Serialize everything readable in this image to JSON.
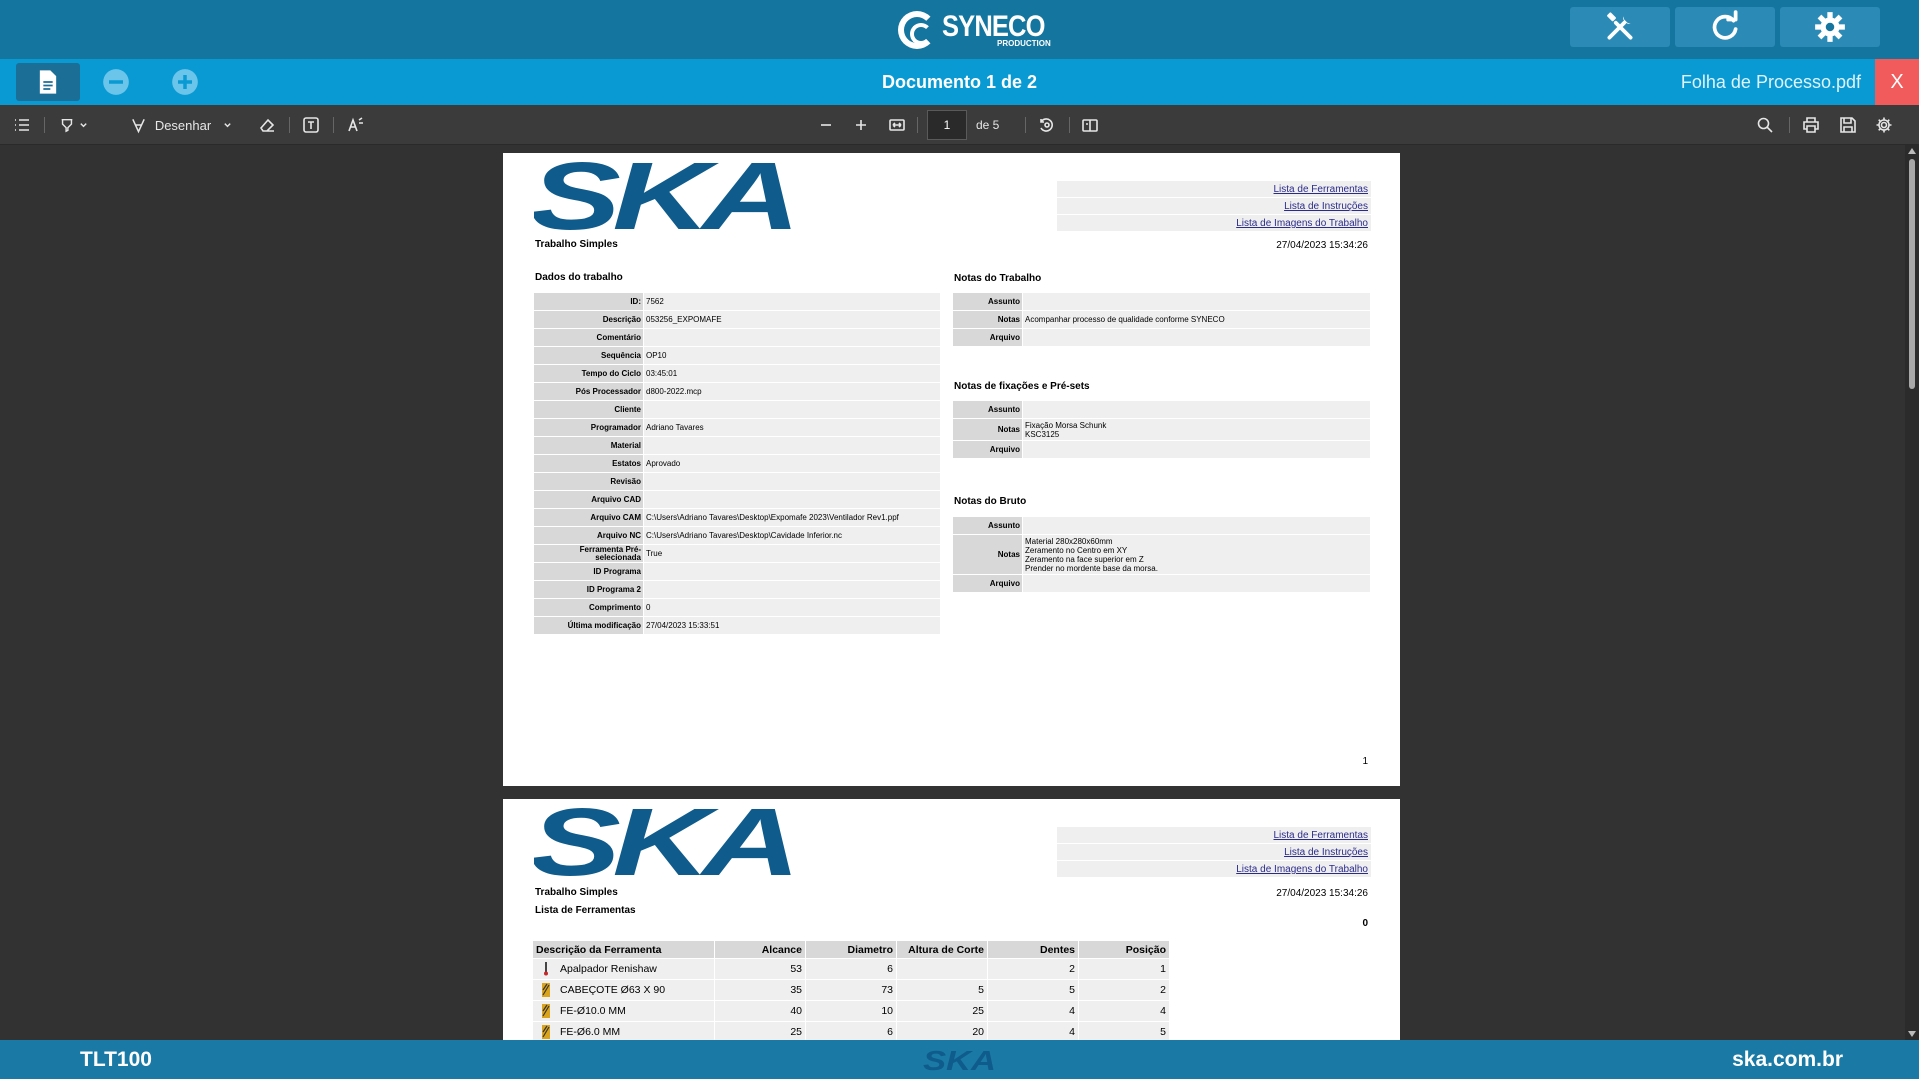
{
  "header": {
    "brand_name": "SYNECO",
    "brand_sub": "PRODUCTION",
    "buttons": [
      "tools-icon",
      "refresh-icon",
      "gear-icon"
    ]
  },
  "docbar": {
    "title": "Documento 1 de 2",
    "filename": "Folha de Processo.pdf",
    "close_label": "X"
  },
  "pdf_toolbar": {
    "draw_label": "Desenhar",
    "page_value": "1",
    "page_count": "de 5"
  },
  "page1": {
    "subtitle": "Trabalho Simples",
    "links": [
      "Lista de Ferramentas",
      "Lista de Instruções",
      "Lista de Imagens do Trabalho"
    ],
    "timestamp": "27/04/2023 15:34:26",
    "job_section_title": "Dados do trabalho",
    "job_fields": [
      {
        "k": "ID:",
        "v": "7562"
      },
      {
        "k": "Descrição",
        "v": "053256_EXPOMAFE"
      },
      {
        "k": "Comentário",
        "v": ""
      },
      {
        "k": "Sequência",
        "v": "OP10"
      },
      {
        "k": "Tempo do Ciclo",
        "v": "03:45:01"
      },
      {
        "k": "Pós Processador",
        "v": "d800-2022.mcp"
      },
      {
        "k": "Cliente",
        "v": ""
      },
      {
        "k": "Programador",
        "v": "Adriano Tavares"
      },
      {
        "k": "Material",
        "v": ""
      },
      {
        "k": "Estatos",
        "v": "Aprovado"
      },
      {
        "k": "Revisão",
        "v": ""
      },
      {
        "k": "Arquivo CAD",
        "v": ""
      },
      {
        "k": "Arquivo CAM",
        "v": "C:\\Users\\Adriano Tavares\\Desktop\\Expomafe 2023\\Ventilador Rev1.ppf"
      },
      {
        "k": "Arquivo NC",
        "v": "C:\\Users\\Adriano Tavares\\Desktop\\Cavidade Inferior.nc"
      },
      {
        "k": "Ferramenta Pré-selecionada",
        "v": "True"
      },
      {
        "k": "ID Programa",
        "v": ""
      },
      {
        "k": "ID Programa 2",
        "v": ""
      },
      {
        "k": "Comprimento",
        "v": "0"
      },
      {
        "k": "Última modificação",
        "v": "27/04/2023 15:33:51"
      }
    ],
    "notes_title": "Notas do Trabalho",
    "notes_fields": [
      {
        "k": "Assunto",
        "v": ""
      },
      {
        "k": "Notas",
        "v": "Acompanhar processo de qualidade conforme SYNECO"
      },
      {
        "k": "Arquivo",
        "v": ""
      }
    ],
    "fix_title": "Notas de fixações e Pré-sets",
    "fix_fields": [
      {
        "k": "Assunto",
        "v": ""
      },
      {
        "k": "Notas",
        "v": "Fixação Morsa Schunk\nKSC3125"
      },
      {
        "k": "Arquivo",
        "v": ""
      }
    ],
    "raw_title": "Notas do Bruto",
    "raw_fields": [
      {
        "k": "Assunto",
        "v": ""
      },
      {
        "k": "Notas",
        "v": "Material 280x280x60mm\nZeramento no Centro em XY\nZeramento na face superior em Z\nPrender no mordente base da morsa."
      },
      {
        "k": "Arquivo",
        "v": ""
      }
    ],
    "page_number": "1"
  },
  "page2": {
    "subtitle": "Trabalho Simples",
    "list_title": "Lista de Ferramentas",
    "links": [
      "Lista de Ferramentas",
      "Lista de Instruções",
      "Lista de Imagens do Trabalho"
    ],
    "timestamp": "27/04/2023 15:34:26",
    "zero": "0",
    "columns": [
      "Descrição da Ferramenta",
      "Alcance",
      "Diametro",
      "Altura de Corte",
      "Dentes",
      "Posição"
    ],
    "rows": [
      [
        "Apalpador Renishaw",
        "53",
        "6",
        "",
        "2",
        "1"
      ],
      [
        "CABEÇOTE Ø63 X 90",
        "35",
        "73",
        "5",
        "5",
        "2"
      ],
      [
        "FE-Ø10.0 MM",
        "40",
        "10",
        "25",
        "4",
        "4"
      ],
      [
        "FE-Ø6.0 MM",
        "25",
        "6",
        "20",
        "4",
        "5"
      ]
    ]
  },
  "footer": {
    "left": "TLT100",
    "right": "ska.com.br"
  }
}
